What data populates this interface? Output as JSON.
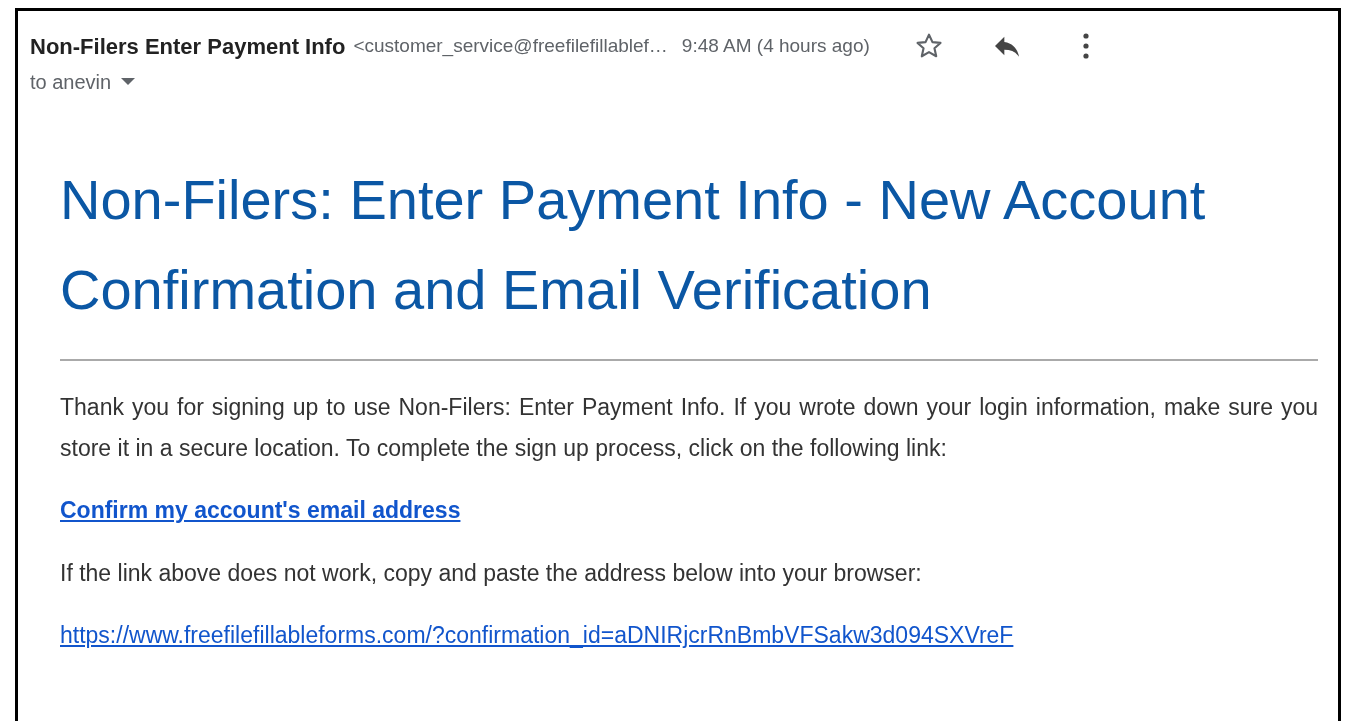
{
  "header": {
    "sender_name": "Non-Filers Enter Payment Info",
    "sender_email": "<customer_service@freefilefillablef…",
    "time": "9:48 AM (4 hours ago)",
    "recipient": "to anevin"
  },
  "email": {
    "heading": "Non-Filers: Enter Payment Info - New Account Confirmation and Email Verification",
    "intro": "Thank you for signing up to use Non-Filers: Enter Payment Info. If you wrote down your login information, make sure you store it in a secure location. To complete the sign up process, click on the following link:",
    "confirm_link": "Confirm my account's email address",
    "fallback_text": "If the link above does not work, copy and paste the address below into your browser:",
    "url": "https://www.freefilefillableforms.com/?confirmation_id=aDNIRjcrRnBmbVFSakw3d094SXVreF"
  }
}
